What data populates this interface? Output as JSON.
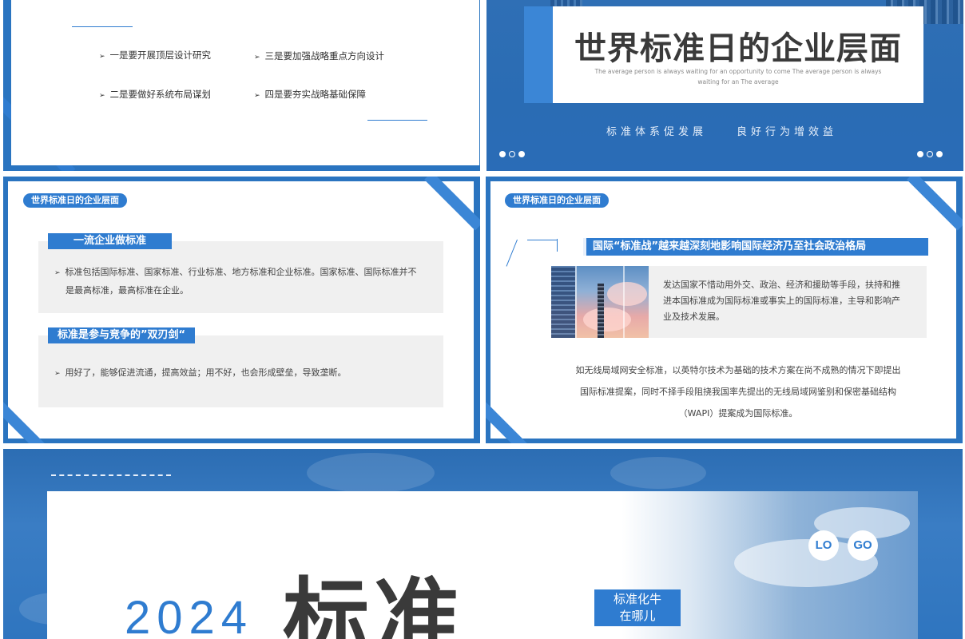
{
  "slide1": {
    "bullets": [
      "一是要开展顶层设计研究",
      "三是要加强战略重点方向设计",
      "二是要做好系统布局谋划",
      "四是要夯实战略基础保障"
    ]
  },
  "slide2": {
    "title": "世界标准日的企业层面",
    "subtitle_line1": "The average person is always waiting for an opportunity to come The average person is always",
    "subtitle_line2": "waiting for an The average",
    "slogan_left": "标准体系促发展",
    "slogan_right": "良好行为增效益"
  },
  "slide3": {
    "tag": "世界标准日的企业层面",
    "box1_title": "一流企业做标准",
    "box1_text_line1": "标准包括国际标准、国家标准、行业标准、地方标准和企业标准。国家标准、国际标准并不",
    "box1_text_line2": "是最高标准，最高标准在企业。",
    "box2_title": "标准是参与竞争的”双刃剑“",
    "box2_text": "用好了，能够促进流通，提高效益；用不好，也会形成壁垒，导致垄断。"
  },
  "slide4": {
    "tag": "世界标准日的企业层面",
    "headline": "国际“标准战”越来越深刻地影响国际经济乃至社会政治格局",
    "box_text_line1": "发达国家不惜动用外交、政治、经济和援助等手段，扶持和推",
    "box_text_line2": "进本国标准成为国际标准或事实上的国际标准，主导和影响产",
    "box_text_line3": "业及技术发展。",
    "para_line1": "如无线局域网安全标准，以英特尔技术为基础的技术方案在尚不成熟的情况下即提出",
    "para_line2": "国际标准提案，同时不择手段阻挠我国率先提出的无线局域网鉴别和保密基础结构",
    "para_line3": "（WAPI）提案成为国际标准。"
  },
  "slide5": {
    "logo_left": "LO",
    "logo_right": "GO",
    "year": "2024",
    "big_title": "标准",
    "label_line1": "标准化牛",
    "label_line2": "在哪儿"
  },
  "colors": {
    "brand_blue": "#2f7cd0",
    "frame_blue": "#2a74c0",
    "panel_gray": "#f0f0f0",
    "title_dark": "#3a3a3a"
  }
}
